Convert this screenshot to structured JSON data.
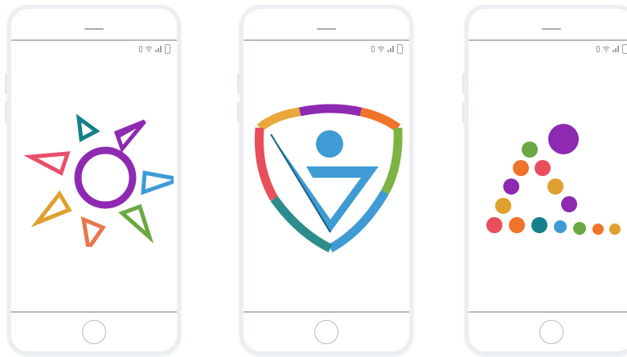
{
  "phones": [
    {
      "id": "phone-1",
      "logo": "sun-ring-logo",
      "colors": [
        "#16808a",
        "#8e2ab1",
        "#3f9bd4",
        "#6aa842",
        "#e94f6b",
        "#e0a02f",
        "#e8764b"
      ]
    },
    {
      "id": "phone-2",
      "logo": "shield-v-logo",
      "colors": [
        "#e8a93a",
        "#8e2ab1",
        "#f0732a",
        "#7cb342",
        "#2f8c8c",
        "#1b5e84",
        "#e94f5a",
        "#3f9bd4"
      ]
    },
    {
      "id": "phone-3",
      "logo": "dot-triangle-logo",
      "colors": [
        "#8e2ab1",
        "#6aa842",
        "#e94f5a",
        "#f0732a",
        "#e0a02f",
        "#16808a",
        "#3f9bd4"
      ]
    }
  ],
  "status_icons": [
    "battery-small-icon",
    "wifi-icon",
    "signal-icon",
    "battery-icon"
  ]
}
